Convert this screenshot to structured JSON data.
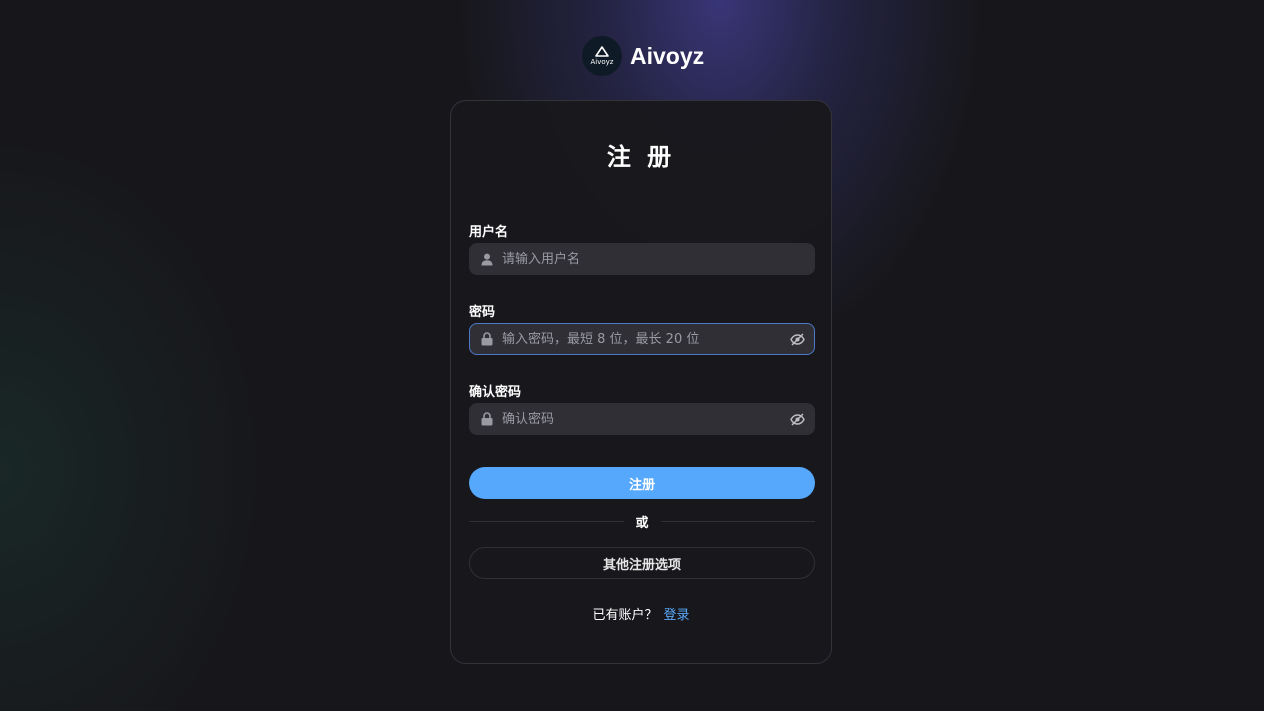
{
  "brand": {
    "logo_text": "Aivoyz",
    "name": "Aivoyz"
  },
  "form": {
    "title": "注 册",
    "username": {
      "label": "用户名",
      "placeholder": "请输入用户名",
      "icon": "user-icon"
    },
    "password": {
      "label": "密码",
      "placeholder": "输入密码，最短 8 位，最长 20 位",
      "icon": "lock-icon",
      "toggle_icon": "eye-off-icon"
    },
    "confirm_password": {
      "label": "确认密码",
      "placeholder": "确认密码",
      "icon": "lock-icon",
      "toggle_icon": "eye-off-icon"
    },
    "submit_label": "注册",
    "divider_text": "或",
    "other_options_label": "其他注册选项",
    "footer_text": "已有账户？",
    "login_link": "登录"
  },
  "colors": {
    "accent": "#55a8fb",
    "link": "#5aa9f7",
    "focus_border": "#4f79c8",
    "background": "#17171b",
    "card": "#18181c",
    "input": "#2f2f35"
  }
}
